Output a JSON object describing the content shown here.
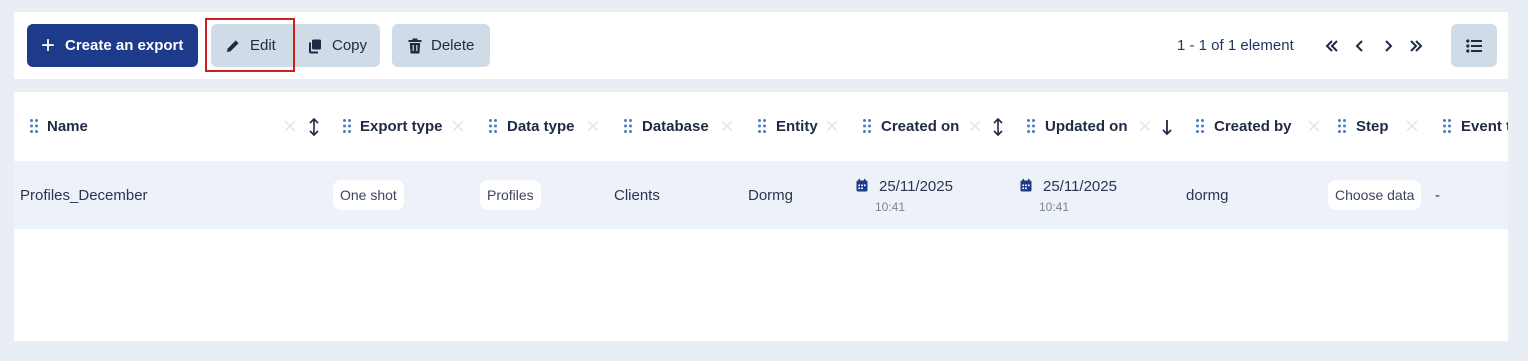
{
  "toolbar": {
    "create_label": "Create an export",
    "edit_label": "Edit",
    "copy_label": "Copy",
    "delete_label": "Delete",
    "pagination_text": "1 - 1 of 1 element",
    "icons": [
      "plus-icon",
      "pencil-icon",
      "copy-icon",
      "trash-icon",
      "first-page-icon",
      "prev-page-icon",
      "next-page-icon",
      "last-page-icon",
      "list-view-icon"
    ]
  },
  "table": {
    "columns": [
      "Name",
      "Export type",
      "Data type",
      "Database",
      "Entity",
      "Created on",
      "Updated on",
      "Created by",
      "Step",
      "Event t"
    ],
    "rows": [
      {
        "name": "Profiles_December",
        "export_type": "One shot",
        "data_type": "Profiles",
        "database": "Clients",
        "entity": "Dormg",
        "created_date": "25/11/2025",
        "created_time": "10:41",
        "updated_date": "25/11/2025",
        "updated_time": "10:41",
        "created_by": "dormg",
        "step": "Choose data",
        "event": "-"
      }
    ]
  },
  "colors": {
    "primary": "#1e3a8a",
    "button_bg": "#cfdbe6",
    "row_bg": "#edf1f8",
    "highlight": "#d01f1f"
  }
}
